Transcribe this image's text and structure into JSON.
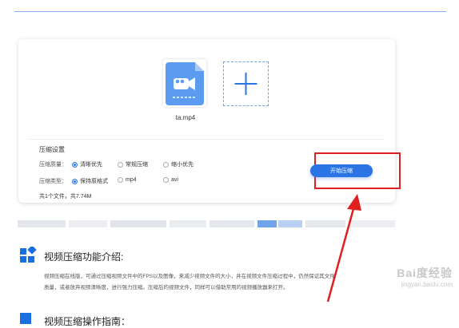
{
  "file": {
    "name": "ta.mp4"
  },
  "settings": {
    "title": "压缩设置",
    "quality": {
      "label": "压缩质量：",
      "options": [
        "清晰优先",
        "常规压缩",
        "缩小优先"
      ],
      "selected_index": 0
    },
    "type": {
      "label": "压缩类型：",
      "options": [
        "保持原格式",
        "mp4",
        "avi"
      ],
      "selected_index": 0
    }
  },
  "summary": "共1个文件，共7.74M",
  "start_button": "开始压缩",
  "intro": {
    "title": "视频压缩功能介绍:",
    "line1": "视频压缩在线版，可通过压缩视频文件中的FPS以及图像，来减少视频文件的大小，并在视频文件压缩过程中，仍然保证其文件",
    "line2": "质量，或者放弃视频清晰度，进行强力压缩。压缩后的视频文件，同样可以借助常用的视频播放器来打开。"
  },
  "guide": {
    "title": "视频压缩操作指南："
  },
  "watermark": {
    "main": "Bai度经验",
    "sub": "jingyan.baidu.com"
  },
  "colors": {
    "accent": "#2a74e6",
    "highlight": "#e02020"
  }
}
